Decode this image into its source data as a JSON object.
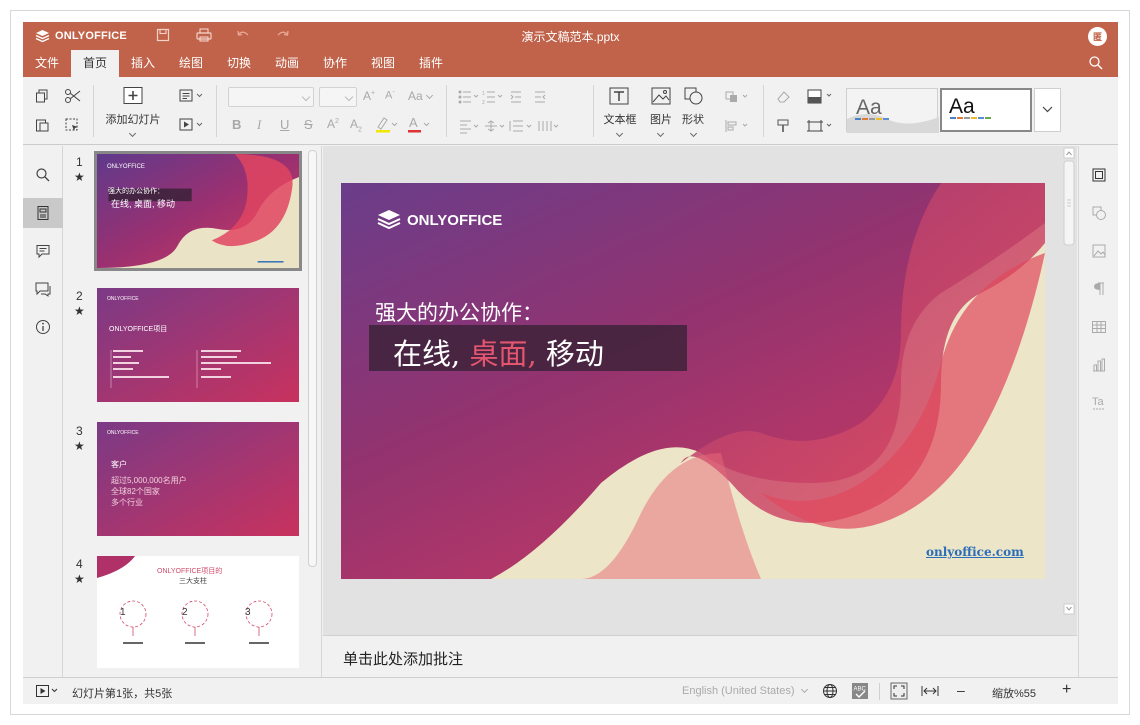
{
  "app": {
    "brand": "ONLYOFFICE",
    "doc_title": "演示文稿范本.pptx",
    "avatar": "匿"
  },
  "tabs": [
    "文件",
    "首页",
    "插入",
    "绘图",
    "切换",
    "动画",
    "协作",
    "视图",
    "插件"
  ],
  "active_tab": "首页",
  "toolbar": {
    "add_slide": "添加幻灯片",
    "text_box": "文本框",
    "image": "图片",
    "shape": "形状",
    "theme_sample": "Aa"
  },
  "thumbnails": [
    {
      "num": "1",
      "star": "★"
    },
    {
      "num": "2",
      "star": "★"
    },
    {
      "num": "3",
      "star": "★"
    },
    {
      "num": "4",
      "star": "★"
    }
  ],
  "thumb_text": {
    "t1_title": "强大的办公协作：",
    "t1_sub": "在线, 桌面, 移动",
    "t2_title": "ONLYOFFICE项目",
    "t3_title": "客户",
    "t3_lines": [
      "超过5,000,000名用户",
      "全球82个国家",
      "多个行业"
    ],
    "t4_title": "ONLYOFFICE项目的",
    "t4_sub": "三大支柱",
    "t4_labels": [
      "1",
      "2",
      "3"
    ]
  },
  "slide": {
    "brand": "ONLYOFFICE",
    "title": "强大的办公协作：",
    "sub_a": "在线,",
    "sub_b": "桌面,",
    "sub_c": "移动",
    "link": "onlyoffice.com"
  },
  "notes_placeholder": "单击此处添加批注",
  "status": {
    "slide_info": "幻灯片第1张，共5张",
    "language": "English (United States)",
    "zoom": "缩放%55"
  },
  "colors": {
    "header": "#c1634a",
    "accent": "#e4556f",
    "link": "#2a6db8"
  }
}
